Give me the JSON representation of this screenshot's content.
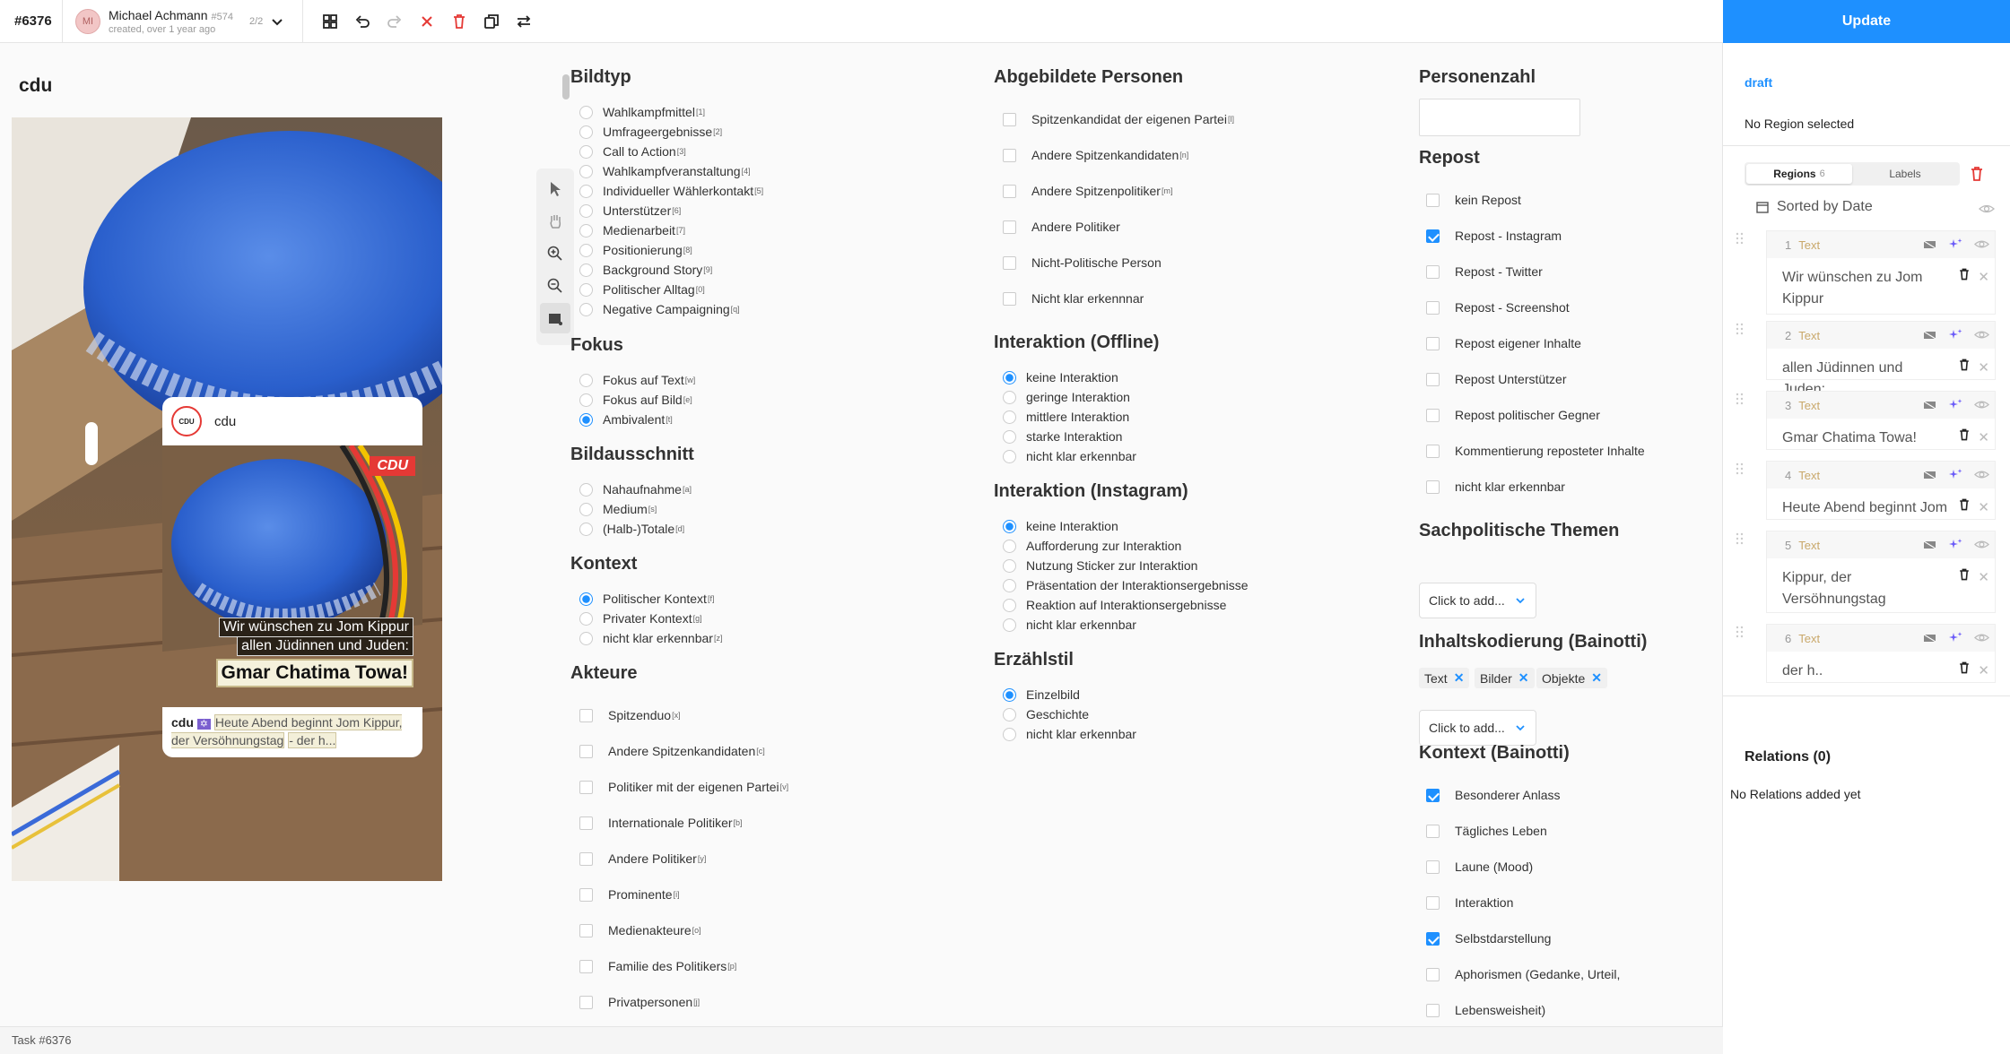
{
  "topbar": {
    "task_id": "#6376",
    "user_initials": "MI",
    "user_name": "Michael Achmann",
    "user_num": "#574",
    "user_sub": "created, over 1 year ago",
    "pager": "2/2"
  },
  "update_label": "Update",
  "main": {
    "image_title": "cdu",
    "image": {
      "account": "cdu",
      "logo": "CDU",
      "overlay_line1": "Wir wünschen zu Jom Kippur",
      "overlay_line2": "allen Jüdinnen und Juden:",
      "overlay_line3": "Gmar Chatima Towa!",
      "caption_account": "cdu",
      "caption_text": "Heute Abend beginnt Jom Kippur, der Versöhnungstag",
      "caption_more": "- der h..."
    }
  },
  "form": {
    "bildtyp": {
      "title": "Bildtyp",
      "options": [
        {
          "label": "Wahlkampfmittel",
          "sup": "[1]"
        },
        {
          "label": "Umfrageergebnisse",
          "sup": "[2]"
        },
        {
          "label": "Call to Action",
          "sup": "[3]"
        },
        {
          "label": "Wahlkampfveranstaltung",
          "sup": "[4]"
        },
        {
          "label": "Individueller Wählerkontakt",
          "sup": "[5]"
        },
        {
          "label": "Unterstützer",
          "sup": "[6]"
        },
        {
          "label": "Medienarbeit",
          "sup": "[7]"
        },
        {
          "label": "Positionierung",
          "sup": "[8]"
        },
        {
          "label": "Background Story",
          "sup": "[9]"
        },
        {
          "label": "Politischer Alltag",
          "sup": "[0]"
        },
        {
          "label": "Negative Campaigning",
          "sup": "[q]"
        }
      ]
    },
    "fokus": {
      "title": "Fokus",
      "options": [
        {
          "label": "Fokus auf Text",
          "sup": "[w]",
          "checked": false
        },
        {
          "label": "Fokus auf Bild",
          "sup": "[e]",
          "checked": false
        },
        {
          "label": "Ambivalent",
          "sup": "[t]",
          "checked": true
        }
      ]
    },
    "bildausschnitt": {
      "title": "Bildausschnitt",
      "options": [
        {
          "label": "Nahaufnahme",
          "sup": "[a]"
        },
        {
          "label": "Medium",
          "sup": "[s]"
        },
        {
          "label": "(Halb-)Totale",
          "sup": "[d]"
        }
      ]
    },
    "kontext": {
      "title": "Kontext",
      "options": [
        {
          "label": "Politischer Kontext",
          "sup": "[f]",
          "checked": true
        },
        {
          "label": "Privater Kontext",
          "sup": "[g]",
          "checked": false
        },
        {
          "label": "nicht klar erkennbar",
          "sup": "[z]",
          "checked": false
        }
      ]
    },
    "akteure": {
      "title": "Akteure",
      "options": [
        {
          "label": "Spitzenduo",
          "sup": "[x]"
        },
        {
          "label": "Andere Spitzenkandidaten",
          "sup": "[c]"
        },
        {
          "label": "Politiker mit der eigenen Partei",
          "sup": "[v]"
        },
        {
          "label": "Internationale Politiker",
          "sup": "[b]"
        },
        {
          "label": "Andere Politiker",
          "sup": "[y]"
        },
        {
          "label": "Prominente",
          "sup": "[i]"
        },
        {
          "label": "Medienakteure",
          "sup": "[o]"
        },
        {
          "label": "Familie des Politikers",
          "sup": "[p]"
        },
        {
          "label": "Privatpersonen",
          "sup": "[j]"
        }
      ]
    },
    "abgebildete": {
      "title": "Abgebildete Personen",
      "options": [
        {
          "label": "Spitzenkandidat der eigenen Partei",
          "sup": "[l]"
        },
        {
          "label": "Andere Spitzenkandidaten",
          "sup": "[n]"
        },
        {
          "label": "Andere Spitzenpolitiker",
          "sup": "[m]"
        },
        {
          "label": "Andere Politiker",
          "sup": ""
        },
        {
          "label": "Nicht-Politische Person",
          "sup": ""
        },
        {
          "label": "Nicht klar erkennnar",
          "sup": ""
        }
      ]
    },
    "interaktion_offline": {
      "title": "Interaktion (Offline)",
      "options": [
        {
          "label": "keine Interaktion",
          "checked": true
        },
        {
          "label": "geringe Interaktion",
          "checked": false
        },
        {
          "label": "mittlere Interaktion",
          "checked": false
        },
        {
          "label": "starke Interaktion",
          "checked": false
        },
        {
          "label": "nicht klar erkennbar",
          "checked": false
        }
      ]
    },
    "interaktion_instagram": {
      "title": "Interaktion (Instagram)",
      "options": [
        {
          "label": "keine Interaktion",
          "checked": true
        },
        {
          "label": "Aufforderung zur Interaktion",
          "checked": false
        },
        {
          "label": "Nutzung Sticker zur Interaktion",
          "checked": false
        },
        {
          "label": "Präsentation der Interaktionsergebnisse",
          "checked": false
        },
        {
          "label": "Reaktion auf Interaktionsergebnisse",
          "checked": false
        },
        {
          "label": "nicht klar erkennbar",
          "checked": false
        }
      ]
    },
    "erzaehlstil": {
      "title": "Erzählstil",
      "options": [
        {
          "label": "Einzelbild",
          "checked": true
        },
        {
          "label": "Geschichte",
          "checked": false
        },
        {
          "label": "nicht klar erkennbar",
          "checked": false
        }
      ]
    },
    "personenzahl": {
      "title": "Personenzahl"
    },
    "repost": {
      "title": "Repost",
      "options": [
        {
          "label": "kein Repost",
          "checked": false
        },
        {
          "label": "Repost - Instagram",
          "checked": true
        },
        {
          "label": "Repost - Twitter",
          "checked": false
        },
        {
          "label": "Repost - Screenshot",
          "checked": false
        },
        {
          "label": "Repost eigener Inhalte",
          "checked": false
        },
        {
          "label": "Repost Unterstützer",
          "checked": false
        },
        {
          "label": "Repost politischer Gegner",
          "checked": false
        },
        {
          "label": "Kommentierung reposteter Inhalte",
          "checked": false
        },
        {
          "label": "nicht klar erkennbar",
          "checked": false
        }
      ]
    },
    "sachpolitische": {
      "title": "Sachpolitische Themen",
      "dropdown": "Click to add..."
    },
    "inhaltskodierung": {
      "title": "Inhaltskodierung (Bainotti)",
      "tags": [
        "Text",
        "Bilder",
        "Objekte"
      ],
      "dropdown": "Click to add..."
    },
    "kontext_bainotti": {
      "title": "Kontext (Bainotti)",
      "options": [
        {
          "label": "Besonderer Anlass",
          "checked": true
        },
        {
          "label": "Tägliches Leben",
          "checked": false
        },
        {
          "label": "Laune (Mood)",
          "checked": false
        },
        {
          "label": "Interaktion",
          "checked": false
        },
        {
          "label": "Selbstdarstellung",
          "checked": true
        },
        {
          "label": "Aphorismen (Gedanke, Urteil,",
          "checked": false
        },
        {
          "label": "Lebensweisheit)",
          "checked": false
        }
      ]
    }
  },
  "sidebar": {
    "draft": "draft",
    "no_region": "No Region selected",
    "tab_regions": "Regions",
    "tab_regions_count": "6",
    "tab_labels": "Labels",
    "sorted": "Sorted by Date",
    "regions": [
      {
        "num": "1",
        "type": "Text",
        "text": "Wir wünschen zu Jom Kippur"
      },
      {
        "num": "2",
        "type": "Text",
        "text": "allen Jüdinnen und Juden:"
      },
      {
        "num": "3",
        "type": "Text",
        "text": "Gmar Chatima Towa!"
      },
      {
        "num": "4",
        "type": "Text",
        "text": "Heute Abend beginnt Jom"
      },
      {
        "num": "5",
        "type": "Text",
        "text": "Kippur, der Versöhnungstag"
      },
      {
        "num": "6",
        "type": "Text",
        "text": "der h.."
      }
    ],
    "relations_title": "Relations (0)",
    "relations_none": "No Relations added yet"
  },
  "status": "Task #6376",
  "colors": {
    "accent": "#1e90ff",
    "danger": "#e53935",
    "region_type": "#c9a86a"
  }
}
